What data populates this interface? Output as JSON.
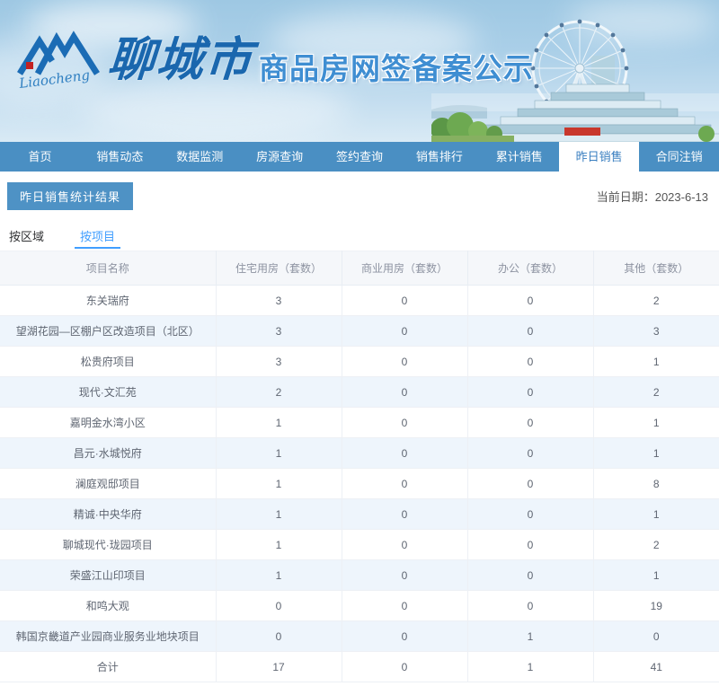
{
  "header": {
    "logo_script": "Liaocheng",
    "brand_city": "聊城市",
    "site_title": "商品房网签备案公示"
  },
  "nav": {
    "items": [
      {
        "id": "home",
        "label": "首页",
        "active": false
      },
      {
        "id": "sales-trends",
        "label": "销售动态",
        "active": false
      },
      {
        "id": "data-monitor",
        "label": "数据监测",
        "active": false
      },
      {
        "id": "listing-search",
        "label": "房源查询",
        "active": false
      },
      {
        "id": "contract-search",
        "label": "签约查询",
        "active": false
      },
      {
        "id": "sales-ranking",
        "label": "销售排行",
        "active": false
      },
      {
        "id": "total-sales",
        "label": "累计销售",
        "active": false
      },
      {
        "id": "yesterday-sales",
        "label": "昨日销售",
        "active": true
      },
      {
        "id": "contract-cancel",
        "label": "合同注销",
        "active": false
      }
    ]
  },
  "content": {
    "section_title": "昨日销售统计结果",
    "date_label": "当前日期：",
    "date_value": "2023-6-13",
    "tabs": [
      {
        "id": "by-region",
        "label": "按区域",
        "active": false
      },
      {
        "id": "by-project",
        "label": "按项目",
        "active": true
      }
    ]
  },
  "table": {
    "columns": [
      "项目名称",
      "住宅用房（套数）",
      "商业用房（套数）",
      "办公（套数）",
      "其他（套数）"
    ],
    "rows": [
      [
        "东关瑞府",
        "3",
        "0",
        "0",
        "2"
      ],
      [
        "望湖花园—区棚户区改造项目（北区）",
        "3",
        "0",
        "0",
        "3"
      ],
      [
        "松贵府项目",
        "3",
        "0",
        "0",
        "1"
      ],
      [
        "现代·文汇苑",
        "2",
        "0",
        "0",
        "2"
      ],
      [
        "嘉明金水湾小区",
        "1",
        "0",
        "0",
        "1"
      ],
      [
        "昌元·水城悦府",
        "1",
        "0",
        "0",
        "1"
      ],
      [
        "澜庭观邸项目",
        "1",
        "0",
        "0",
        "8"
      ],
      [
        "精诚·中央华府",
        "1",
        "0",
        "0",
        "1"
      ],
      [
        "聊城现代·珑园项目",
        "1",
        "0",
        "0",
        "2"
      ],
      [
        "荣盛江山印项目",
        "1",
        "0",
        "0",
        "1"
      ],
      [
        "和鸣大观",
        "0",
        "0",
        "0",
        "19"
      ],
      [
        "韩国京畿道产业园商业服务业地块项目",
        "0",
        "0",
        "1",
        "0"
      ]
    ],
    "total_row": [
      "合计",
      "17",
      "0",
      "1",
      "41"
    ]
  },
  "colors": {
    "nav_blue": "#4a8fc3",
    "nav_active_text": "#3a7fc0",
    "badge_blue": "#4e92c5",
    "tab_active_blue": "#409eff",
    "brand_blue": "#1a67ae",
    "title_blue": "#3f8ed2",
    "table_header_bg": "#f5f7fa",
    "row_alt_bg": "#eef5fc",
    "accent_red": "#c8372c"
  }
}
